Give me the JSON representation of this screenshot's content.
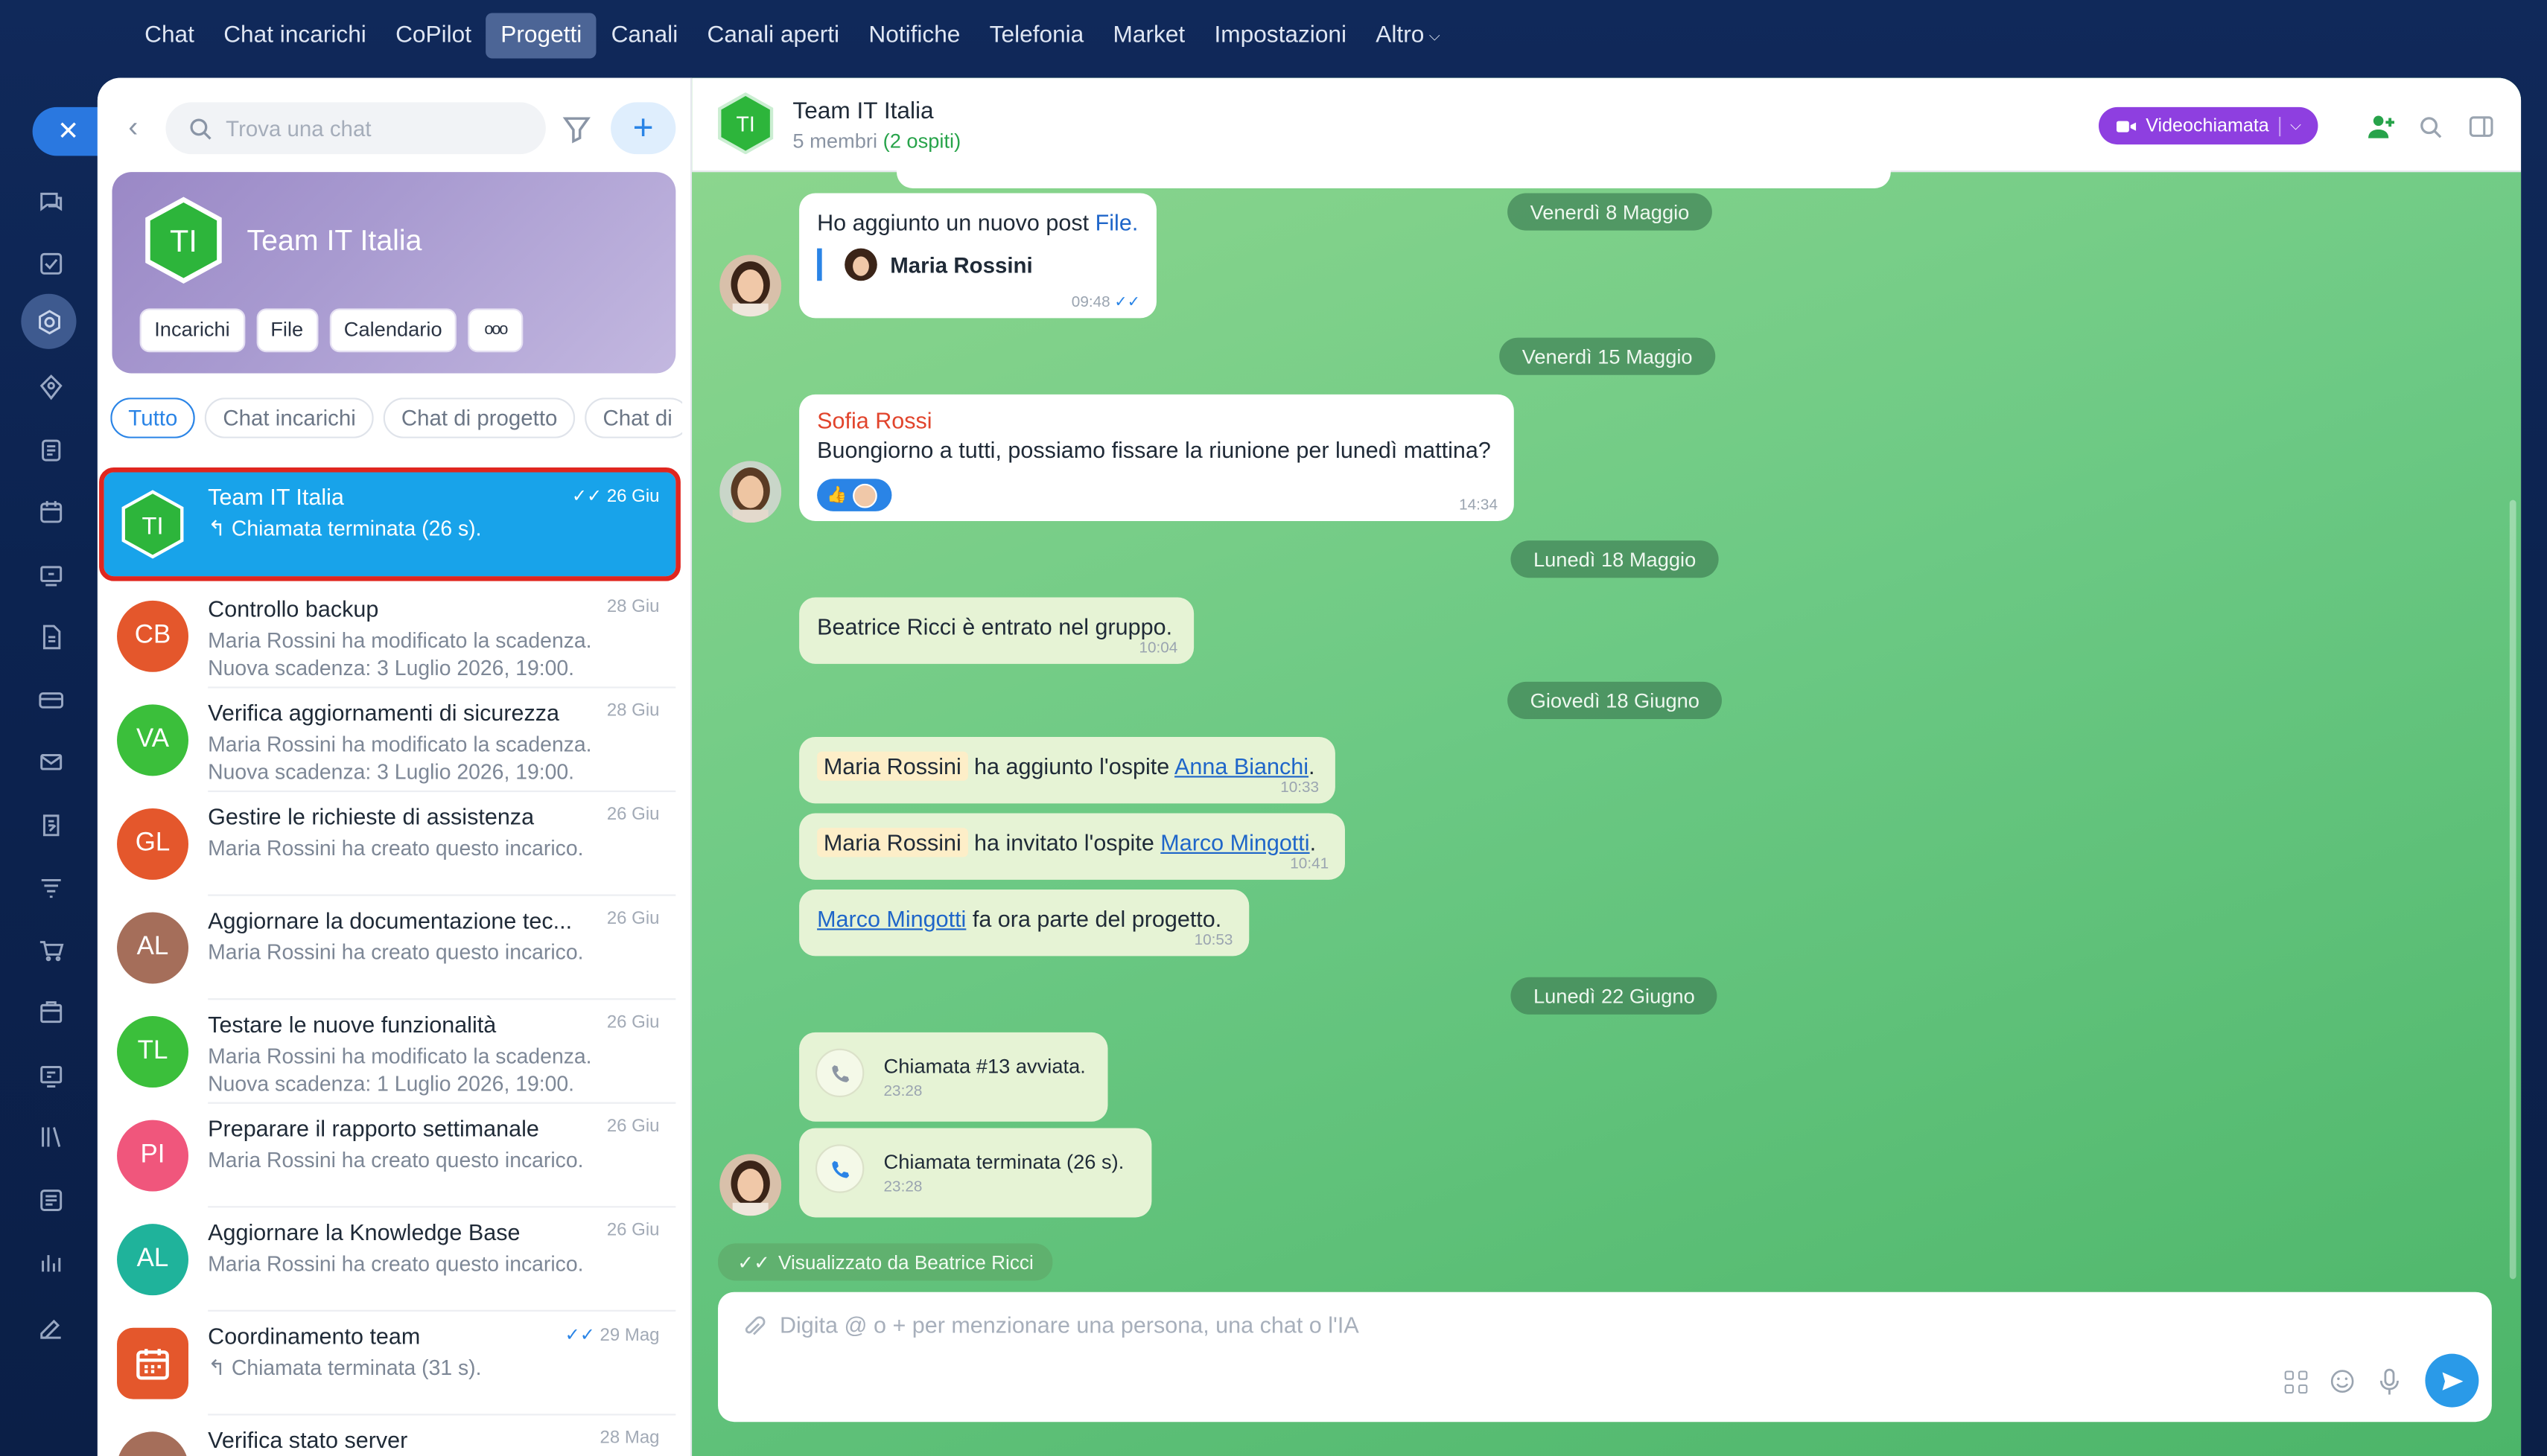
{
  "nav": {
    "items": [
      "Chat",
      "Chat incarichi",
      "CoPilot",
      "Progetti",
      "Canali",
      "Canali aperti",
      "Notifiche",
      "Telefonia",
      "Market",
      "Impostazioni",
      "Altro"
    ],
    "active": "Progetti"
  },
  "rail": {
    "icons": [
      "chat-icon",
      "tasks-icon",
      "projects-icon",
      "collab-icon",
      "feed-icon",
      "calendar-icon",
      "drive-icon",
      "docs-icon",
      "crm-icon",
      "mail-icon",
      "forms-icon",
      "automation-icon",
      "shop-icon",
      "inventory-icon",
      "sites-icon",
      "knowledge-icon",
      "workflow-icon",
      "analytics-icon",
      "sign-icon"
    ]
  },
  "sidebar": {
    "search_placeholder": "Trova una chat",
    "hero": {
      "initials": "TI",
      "title": "Team IT Italia",
      "chips": [
        "Incarichi",
        "File",
        "Calendario",
        "ooo"
      ]
    },
    "filters": [
      "Tutto",
      "Chat incarichi",
      "Chat di progetto",
      "Chat di"
    ],
    "items": [
      {
        "initials": "TI",
        "title": "Team IT Italia",
        "date": "26 Giu",
        "sub1": "Chiamata terminata (26 s).",
        "sub2": "",
        "color": "#2db53b"
      },
      {
        "initials": "CB",
        "title": "Controllo backup",
        "date": "28 Giu",
        "sub1": "Maria Rossini ha modificato la scadenza.",
        "sub2": "Nuova scadenza: 3 Luglio 2026, 19:00.",
        "color": "#e4572c"
      },
      {
        "initials": "VA",
        "title": "Verifica aggiornamenti di sicurezza",
        "date": "28 Giu",
        "sub1": "Maria Rossini ha modificato la scadenza.",
        "sub2": "Nuova scadenza: 3 Luglio 2026, 19:00.",
        "color": "#3bbf3b"
      },
      {
        "initials": "GL",
        "title": "Gestire le richieste di assistenza",
        "date": "26 Giu",
        "sub1": "Maria Rossini ha creato questo incarico.",
        "sub2": "",
        "color": "#e4572c"
      },
      {
        "initials": "AL",
        "title": "Aggiornare la documentazione tec...",
        "date": "26 Giu",
        "sub1": "Maria Rossini ha creato questo incarico.",
        "sub2": "",
        "color": "#a56e5a"
      },
      {
        "initials": "TL",
        "title": "Testare le nuove funzionalità",
        "date": "26 Giu",
        "sub1": "Maria Rossini ha modificato la scadenza.",
        "sub2": "Nuova scadenza: 1 Luglio 2026, 19:00.",
        "color": "#3bbf3b"
      },
      {
        "initials": "PI",
        "title": "Preparare il rapporto settimanale",
        "date": "26 Giu",
        "sub1": "Maria Rossini ha creato questo incarico.",
        "sub2": "",
        "color": "#f0567c"
      },
      {
        "initials": "AL",
        "title": "Aggiornare la Knowledge Base",
        "date": "26 Giu",
        "sub1": "Maria Rossini ha creato questo incarico.",
        "sub2": "",
        "color": "#1fb39b"
      },
      {
        "initials": "",
        "title": "Coordinamento team",
        "date": "29 Mag",
        "sub1": "Chiamata terminata (31 s).",
        "sub2": "",
        "color": "#e4572c"
      },
      {
        "initials": "",
        "title": "Verifica stato server",
        "date": "28 Mag",
        "sub1": "",
        "sub2": "",
        "color": "#a56e5a"
      }
    ]
  },
  "chat": {
    "title": "Team IT Italia",
    "initials": "TI",
    "members": "5 membri",
    "guests": "(2 ospiti)",
    "video_label": "Videochiamata",
    "dates": [
      "Venerdì 8 Maggio",
      "Venerdì 15 Maggio",
      "Lunedì 18 Maggio",
      "Giovedì 18 Giugno",
      "Lunedì 22 Giugno"
    ],
    "msg1": {
      "text": "Ho aggiunto un nuovo post",
      "link": "File.",
      "author": "Maria Rossini",
      "time": "09:48"
    },
    "msg2": {
      "author": "Sofia Rossi",
      "text": "Buongiorno a tutti, possiamo fissare la riunione per lunedì mattina?",
      "time": "14:34"
    },
    "sys1": {
      "text": "Beatrice Ricci è entrato nel gruppo.",
      "time": "10:04"
    },
    "sys2": {
      "mention": "Maria Rossini",
      "text": "ha aggiunto l'ospite",
      "link": "Anna Bianchi",
      "time": "10:33"
    },
    "sys3": {
      "mention": "Maria Rossini",
      "text": "ha invitato l'ospite",
      "link": "Marco Mingotti",
      "time": "10:41"
    },
    "sys4": {
      "link": "Marco Mingotti",
      "text": "fa ora parte del progetto.",
      "time": "10:53"
    },
    "call1": {
      "text": "Chiamata #13 avviata.",
      "time": "23:28"
    },
    "call2": {
      "text": "Chiamata terminata (26 s).",
      "time": "23:28"
    },
    "seen": "Visualizzato da Beatrice Ricci",
    "composer_placeholder": "Digita @ o + per menzionare una persona, una chat o l'IA"
  },
  "colors": {
    "accent": "#2a84e6",
    "selected": "#18a3ea",
    "highlight_border": "#e0261f",
    "video": "#8e3fe0",
    "chat_bg": "#5fc27a"
  }
}
